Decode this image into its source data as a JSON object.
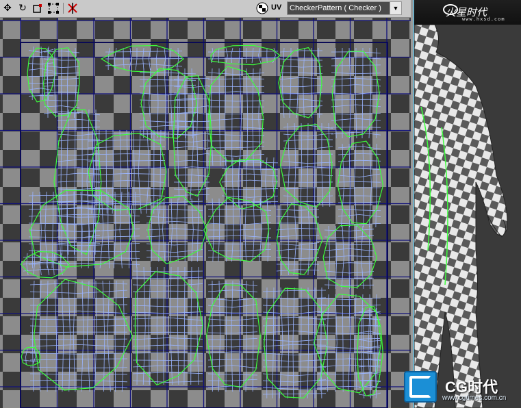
{
  "toolbar": {
    "move_icon": "move-icon",
    "rotate_icon": "rotate-icon",
    "scale_icon": "scale-icon",
    "freeform_icon": "freeform-icon",
    "mirror_icon": "mirror-icon",
    "checker_icon": "checker-toggle-icon",
    "uv_label": "UV",
    "map_dropdown_value": "CheckerPattern  ( Checker )"
  },
  "colors": {
    "uv_edge": "#9ab4ff",
    "seam_edge": "#3cff3c",
    "grid_line": "#10107a",
    "checker_dark": "#3a3a3a",
    "checker_light": "#8c8c8c"
  },
  "viewport": {
    "logo_text": "火星时代",
    "logo_url": "www.hxsd.com"
  },
  "watermark": {
    "title": "CG时代",
    "url": "www.cgtimes.com.cn"
  }
}
